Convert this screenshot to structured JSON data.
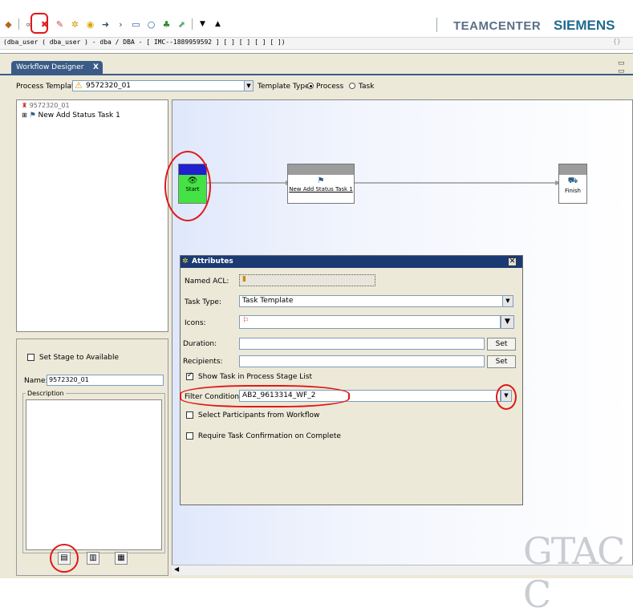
{
  "toolbar": {
    "icons": [
      "tool-1-icon",
      "tool-2-icon",
      "delete-task-icon",
      "tool-4-icon",
      "tool-5-icon",
      "tool-6-icon",
      "tool-7-icon",
      "arrow-right-icon",
      "square-icon",
      "circle-icon",
      "tree-icon",
      "tool-12-icon"
    ],
    "brand_teamcenter": "TEAMCENTER",
    "brand_siemens": "SIEMENS"
  },
  "userbar": {
    "text": "(dba_user ( dba_user ) - dba / DBA - [ IMC--1889959592 ] [ ] [ ] [ ] [ ])"
  },
  "tab": {
    "label": "Workflow Designer",
    "close": "X"
  },
  "process_template": {
    "label": "Process Template",
    "value": "9572320_01",
    "template_type_label": "Template Type",
    "option_process": "Process",
    "option_task": "Task",
    "selected": "Process"
  },
  "tree": {
    "root": "9572320_01",
    "child": "New Add Status Task 1"
  },
  "stage": {
    "checkbox_label": "Set Stage to Available",
    "checked": false
  },
  "name": {
    "label": "Name:",
    "value": "9572320_01"
  },
  "description": {
    "label": "Description",
    "value": ""
  },
  "canvas": {
    "nodes": [
      {
        "id": "start",
        "label": "Start"
      },
      {
        "id": "task",
        "label": "New Add Status Task 1"
      },
      {
        "id": "finish",
        "label": "Finish"
      }
    ]
  },
  "attributes": {
    "title": "Attributes",
    "named_acl_label": "Named ACL:",
    "named_acl_value": "",
    "task_type_label": "Task Type:",
    "task_type_value": "Task Template",
    "icons_label": "Icons:",
    "icons_value": "",
    "duration_label": "Duration:",
    "duration_value": "",
    "recipients_label": "Recipients:",
    "recipients_value": "",
    "set_label": "Set",
    "show_task_label": "Show Task in Process Stage List",
    "show_task_checked": true,
    "filter_label": "Filter Condition:",
    "filter_value": "AB2_9613314_WF_2",
    "select_participants_label": "Select Participants from Workflow",
    "select_participants_checked": false,
    "require_confirm_label": "Require Task Confirmation on Complete",
    "require_confirm_checked": false
  },
  "watermark": "GTAC C",
  "colors": {
    "accent_blue": "#1b3a74",
    "start_green": "#44e244",
    "start_header": "#2020d0",
    "annotation_red": "#e01818"
  }
}
